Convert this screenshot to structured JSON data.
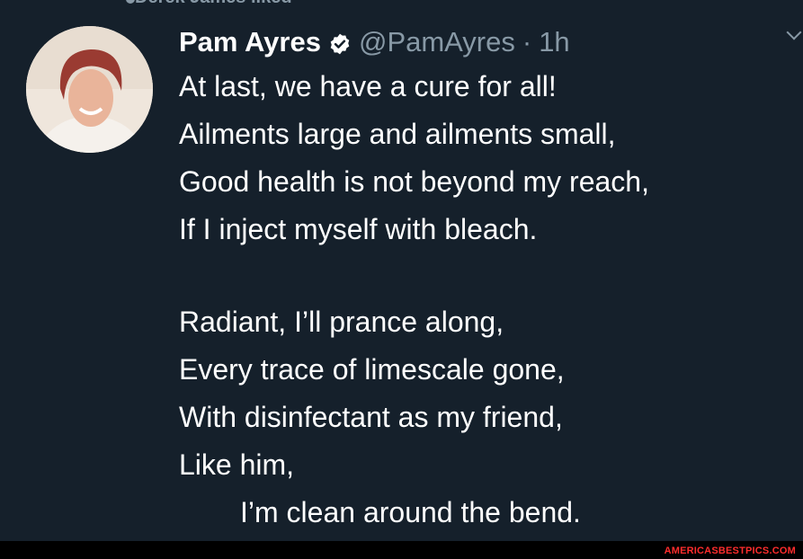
{
  "social_context": {
    "text": "Derek James liked"
  },
  "tweet": {
    "display_name": "Pam Ayres",
    "verified_icon": "verified-badge-icon",
    "handle": "@PamAyres",
    "separator": "·",
    "time": "1h",
    "lines": [
      "At last, we have a cure for all!",
      "Ailments large and ailments small,",
      "Good health is not beyond my reach,",
      "If I inject myself with bleach.",
      "",
      "Radiant, I’ll prance along,",
      "Every trace of limescale gone,",
      "With disinfectant as my friend,",
      "Like him,",
      "I’m clean around the bend."
    ]
  },
  "watermark": {
    "text": "AMERICASBESTPICS.COM"
  },
  "colors": {
    "background": "#15202b",
    "text": "#ffffff",
    "secondary_text": "#8899a6",
    "watermark": "#ff2d2d"
  }
}
